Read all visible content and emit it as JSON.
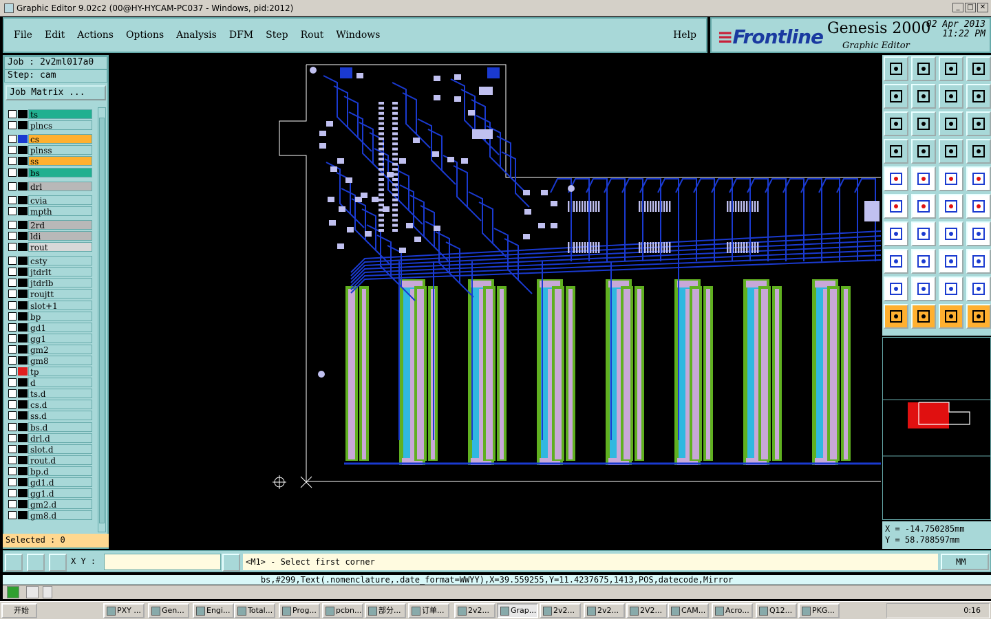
{
  "window": {
    "title": "Graphic Editor 9.02c2 (00@HY-HYCAM-PC037 - Windows, pid:2012)",
    "min_label": "_",
    "max_label": "□",
    "close_label": "✕"
  },
  "menu": {
    "items": [
      "File",
      "Edit",
      "Actions",
      "Options",
      "Analysis",
      "DFM",
      "Step",
      "Rout",
      "Windows"
    ],
    "help": "Help"
  },
  "logo": {
    "brand": "Frontline",
    "product": "Genesis 2000",
    "subtitle": "Graphic Editor",
    "date": "02 Apr 2013",
    "time": "11:22 PM"
  },
  "left": {
    "job": "Job : 2v2ml017a0",
    "step": "Step: cam",
    "job_matrix": "Job Matrix ...",
    "selected": "Selected : 0"
  },
  "layers": [
    {
      "name": "ts",
      "color": "#20b090",
      "swatch": "#000000"
    },
    {
      "name": "plncs",
      "color": "#a8d8d8",
      "swatch": "#000000"
    },
    {
      "name": "cs",
      "color": "#ffb030",
      "swatch": "#1a3ad0"
    },
    {
      "name": "plnss",
      "color": "#a8d8d8",
      "swatch": "#000000"
    },
    {
      "name": "ss",
      "color": "#ffb030",
      "swatch": "#000000"
    },
    {
      "name": "bs",
      "color": "#20b090",
      "swatch": "#000000"
    },
    {
      "name": "drl",
      "color": "#b8b8b8",
      "swatch": "#000000"
    },
    {
      "name": "cvia",
      "color": "#a8d8d8",
      "swatch": "#000000"
    },
    {
      "name": "mpth",
      "color": "#a8d8d8",
      "swatch": "#000000"
    },
    {
      "name": "2rd",
      "color": "#b8b8b8",
      "swatch": "#000000"
    },
    {
      "name": "ldi",
      "color": "#b8b8b8",
      "swatch": "#000000"
    },
    {
      "name": "rout",
      "color": "#d8d8d8",
      "swatch": "#000000"
    },
    {
      "name": "csty",
      "color": "#a8d8d8",
      "swatch": "#000000"
    },
    {
      "name": "jtdrlt",
      "color": "#a8d8d8",
      "swatch": "#000000"
    },
    {
      "name": "jtdrlb",
      "color": "#a8d8d8",
      "swatch": "#000000"
    },
    {
      "name": "roujtt",
      "color": "#a8d8d8",
      "swatch": "#000000"
    },
    {
      "name": "slot+1",
      "color": "#a8d8d8",
      "swatch": "#000000"
    },
    {
      "name": "bp",
      "color": "#a8d8d8",
      "swatch": "#000000"
    },
    {
      "name": "gd1",
      "color": "#a8d8d8",
      "swatch": "#000000"
    },
    {
      "name": "gg1",
      "color": "#a8d8d8",
      "swatch": "#000000"
    },
    {
      "name": "gm2",
      "color": "#a8d8d8",
      "swatch": "#000000"
    },
    {
      "name": "gm8",
      "color": "#a8d8d8",
      "swatch": "#000000"
    },
    {
      "name": "tp",
      "color": "#a8d8d8",
      "swatch": "#e02020"
    },
    {
      "name": "d",
      "color": "#a8d8d8",
      "swatch": "#000000"
    },
    {
      "name": "ts.d",
      "color": "#a8d8d8",
      "swatch": "#000000"
    },
    {
      "name": "cs.d",
      "color": "#a8d8d8",
      "swatch": "#000000"
    },
    {
      "name": "ss.d",
      "color": "#a8d8d8",
      "swatch": "#000000"
    },
    {
      "name": "bs.d",
      "color": "#a8d8d8",
      "swatch": "#000000"
    },
    {
      "name": "drl.d",
      "color": "#a8d8d8",
      "swatch": "#000000"
    },
    {
      "name": "slot.d",
      "color": "#a8d8d8",
      "swatch": "#000000"
    },
    {
      "name": "rout.d",
      "color": "#a8d8d8",
      "swatch": "#000000"
    },
    {
      "name": "bp.d",
      "color": "#a8d8d8",
      "swatch": "#000000"
    },
    {
      "name": "gd1.d",
      "color": "#a8d8d8",
      "swatch": "#000000"
    },
    {
      "name": "gg1.d",
      "color": "#a8d8d8",
      "swatch": "#000000"
    },
    {
      "name": "gm2.d",
      "color": "#a8d8d8",
      "swatch": "#000000"
    },
    {
      "name": "gm8.d",
      "color": "#a8d8d8",
      "swatch": "#000000"
    }
  ],
  "coords": {
    "x": "X = -14.750285mm",
    "y": "Y = 58.788597mm"
  },
  "cmd": {
    "xy_label": "X Y :",
    "xy_value": "",
    "prompt": "<M1> - Select first corner",
    "units": "MM"
  },
  "info": "bs,#299,Text(.nomenclature,.date_format=WWYY),X=39.559255,Y=11.4237675,1413,POS,datecode,Mirror",
  "taskbar": {
    "start": "开始",
    "tasks": [
      "PXY ...",
      "Gen...",
      "Engi...",
      "Total...",
      "Prog...",
      "pcbn...",
      "部分...",
      "订单...",
      "2v2...",
      "Grap...",
      "2v2...",
      "2v2...",
      "2V2...",
      "CAM...",
      "Acro...",
      "Q12...",
      "PKG..."
    ],
    "clock": "0:16"
  },
  "colors": {
    "trace": "#1a3ad0",
    "pad": "#c0c0f0",
    "finger_green": "#60b020",
    "finger_cyan": "#30b8e0",
    "finger_pad": "#c8a8d8"
  }
}
